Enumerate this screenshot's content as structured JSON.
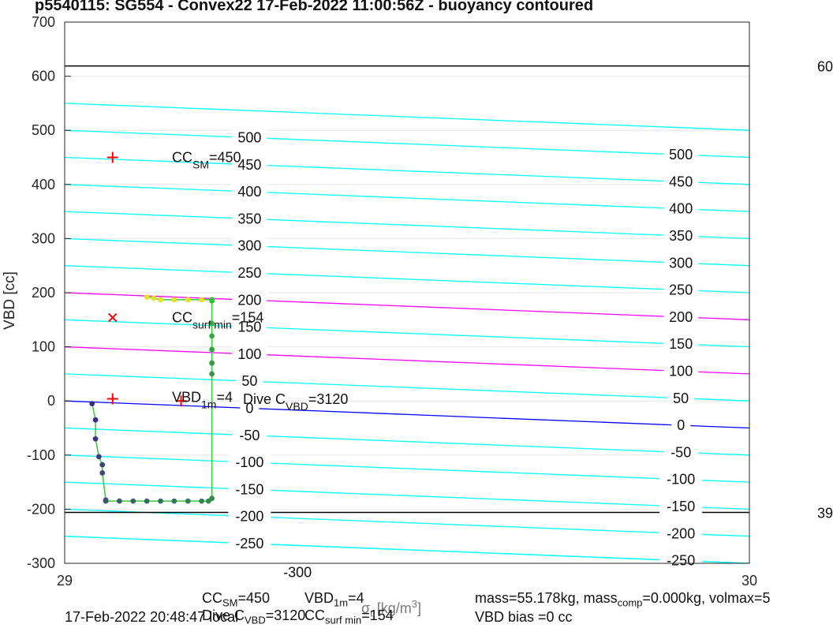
{
  "chart_data": {
    "type": "line",
    "title": "p5540115: SG554 - Convex22 17-Feb-2022 11:00:56Z - buoyancy contoured",
    "xlabel": "",
    "ylabel": "VBD [cc]",
    "xlim": [
      29,
      30
    ],
    "ylim": [
      -300,
      700
    ],
    "x_ticks": [
      29,
      30
    ],
    "y_ticks": [
      -300,
      -200,
      -100,
      0,
      100,
      200,
      300,
      400,
      500,
      600,
      700
    ],
    "grid": true,
    "horizontal_lines": [
      {
        "y": 619,
        "color": "#000000",
        "right_label": "60"
      },
      {
        "y": -206,
        "color": "#000000",
        "right_label": "39"
      }
    ],
    "contours": {
      "color": "#00ffff",
      "slope_cc_per_unit_x": -50,
      "levels": [
        -300,
        -250,
        -200,
        -150,
        -100,
        -50,
        0,
        50,
        100,
        150,
        200,
        250,
        300,
        350,
        400,
        450,
        500
      ],
      "extra_lines": [
        -250,
        550
      ],
      "highlight": [
        {
          "level": 200,
          "color": "#ff00ff"
        },
        {
          "level": 100,
          "color": "#ff00ff"
        },
        {
          "level": 0,
          "color": "#0000ff"
        }
      ],
      "left_labels": [
        "-300",
        "-250",
        "-200",
        "-150",
        "-100",
        "-50",
        "0",
        "50",
        "100",
        "150",
        "200",
        "250",
        "300",
        "350",
        "400",
        "450",
        "500"
      ],
      "right_labels": [
        "-250",
        "-200",
        "-150",
        "-100",
        "-50",
        "0",
        "50",
        "100",
        "150",
        "200",
        "250",
        "300",
        "350",
        "400",
        "450",
        "500"
      ]
    },
    "markers": [
      {
        "x": 29.07,
        "y": 450,
        "symbol": "+",
        "label": "CC",
        "label_sub": "SM",
        "label_suffix": "=450"
      },
      {
        "x": 29.07,
        "y": 154,
        "symbol": "x",
        "label": "CC",
        "label_sub": "surf min",
        "label_suffix": "=154"
      },
      {
        "x": 29.07,
        "y": 4,
        "symbol": "+",
        "label": "VBD",
        "label_sub": "1m",
        "label_suffix": "=4"
      },
      {
        "x": 29.17,
        "y": 0,
        "symbol": "+",
        "label": "Dive C",
        "label_sub": "VBD",
        "label_suffix": "=3120"
      }
    ],
    "series": [
      {
        "color": "#32cd32",
        "x": [
          29.04,
          29.045,
          29.045,
          29.05,
          29.055,
          29.055,
          29.06,
          29.06,
          29.08,
          29.1,
          29.12,
          29.14,
          29.16,
          29.18,
          29.2,
          29.21,
          29.215,
          29.215,
          29.215,
          29.215,
          29.215,
          29.215,
          29.215,
          29.215,
          29.2,
          29.18,
          29.16,
          29.14,
          29.13,
          29.12
        ],
        "y": [
          -5,
          -35,
          -70,
          -103,
          -118,
          -133,
          -183,
          -185,
          -185,
          -185,
          -185,
          -185,
          -185,
          -185,
          -185,
          -185,
          -180,
          50,
          70,
          95,
          120,
          143,
          185,
          187,
          187,
          187,
          187,
          187,
          190,
          192
        ]
      }
    ],
    "footer": {
      "line1": "CC",
      "line1_sub": "SM",
      "line1_suffix": "=450",
      "vbd1m": "VBD",
      "vbd1m_sub": "1m",
      "vbd1m_suffix": "=4",
      "sigma_label": "σ",
      "sigma_sub": "t",
      "units": "[kg/m",
      "units_sup": "3",
      "units_close": "]",
      "mass": "mass=55.178kg, mass",
      "mass_sub": "comp",
      "mass_suffix": "=0.000kg, volmax=5",
      "date": "17-Feb-2022 20:48:47 local",
      "dive": "Dive C",
      "dive_sub": "VBD",
      "dive_suffix": "=3120",
      "ccsurf": "CC",
      "ccsurf_sub": "surf min",
      "ccsurf_suffix": "=154",
      "bias": "VBD bias =0 cc"
    }
  }
}
